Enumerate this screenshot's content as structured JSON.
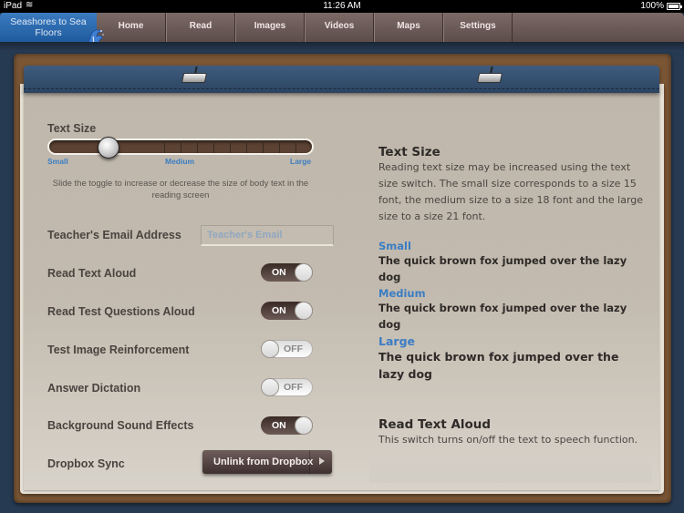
{
  "status_bar": {
    "carrier": "iPad",
    "time": "11:26 AM",
    "battery": "100%"
  },
  "nav": {
    "brand": "Seashores to Sea Floors",
    "tabs": [
      "Home",
      "Read",
      "Images",
      "Videos",
      "Maps",
      "Settings"
    ]
  },
  "settings": {
    "text_size": {
      "label": "Text Size",
      "value": "Small",
      "position_fraction": 0.2,
      "scale": [
        "Small",
        "Medium",
        "Large"
      ],
      "hint": "Slide the toggle to increase or decrease the size of body text in the reading screen"
    },
    "email": {
      "label": "Teacher's Email Address",
      "placeholder": "Teacher's Email",
      "value": ""
    },
    "toggles": [
      {
        "label": "Read Text Aloud",
        "state": "ON"
      },
      {
        "label": "Read Test Questions Aloud",
        "state": "ON"
      },
      {
        "label": "Test Image Reinforcement",
        "state": "OFF"
      },
      {
        "label": "Answer Dictation",
        "state": "OFF"
      },
      {
        "label": "Background Sound Effects",
        "state": "ON"
      }
    ],
    "dropbox": {
      "label": "Dropbox Sync",
      "button": "Unlink from Dropbox"
    }
  },
  "help": {
    "text_size_title": "Text Size",
    "text_size_body": "Reading text size may be increased using the text size switch.  The small size corresponds to a size 15 font, the medium size to a size 18 font and the large size to a size 21 font.",
    "samples": [
      {
        "label": "Small",
        "text": "The quick brown fox jumped over the lazy dog"
      },
      {
        "label": "Medium",
        "text": "The quick brown fox jumped over the lazy dog"
      },
      {
        "label": "Large",
        "text": "The quick brown fox jumped over the lazy dog"
      }
    ],
    "read_aloud_title": "Read Text Aloud",
    "read_aloud_body": "This switch turns on/off the text to speech function."
  }
}
